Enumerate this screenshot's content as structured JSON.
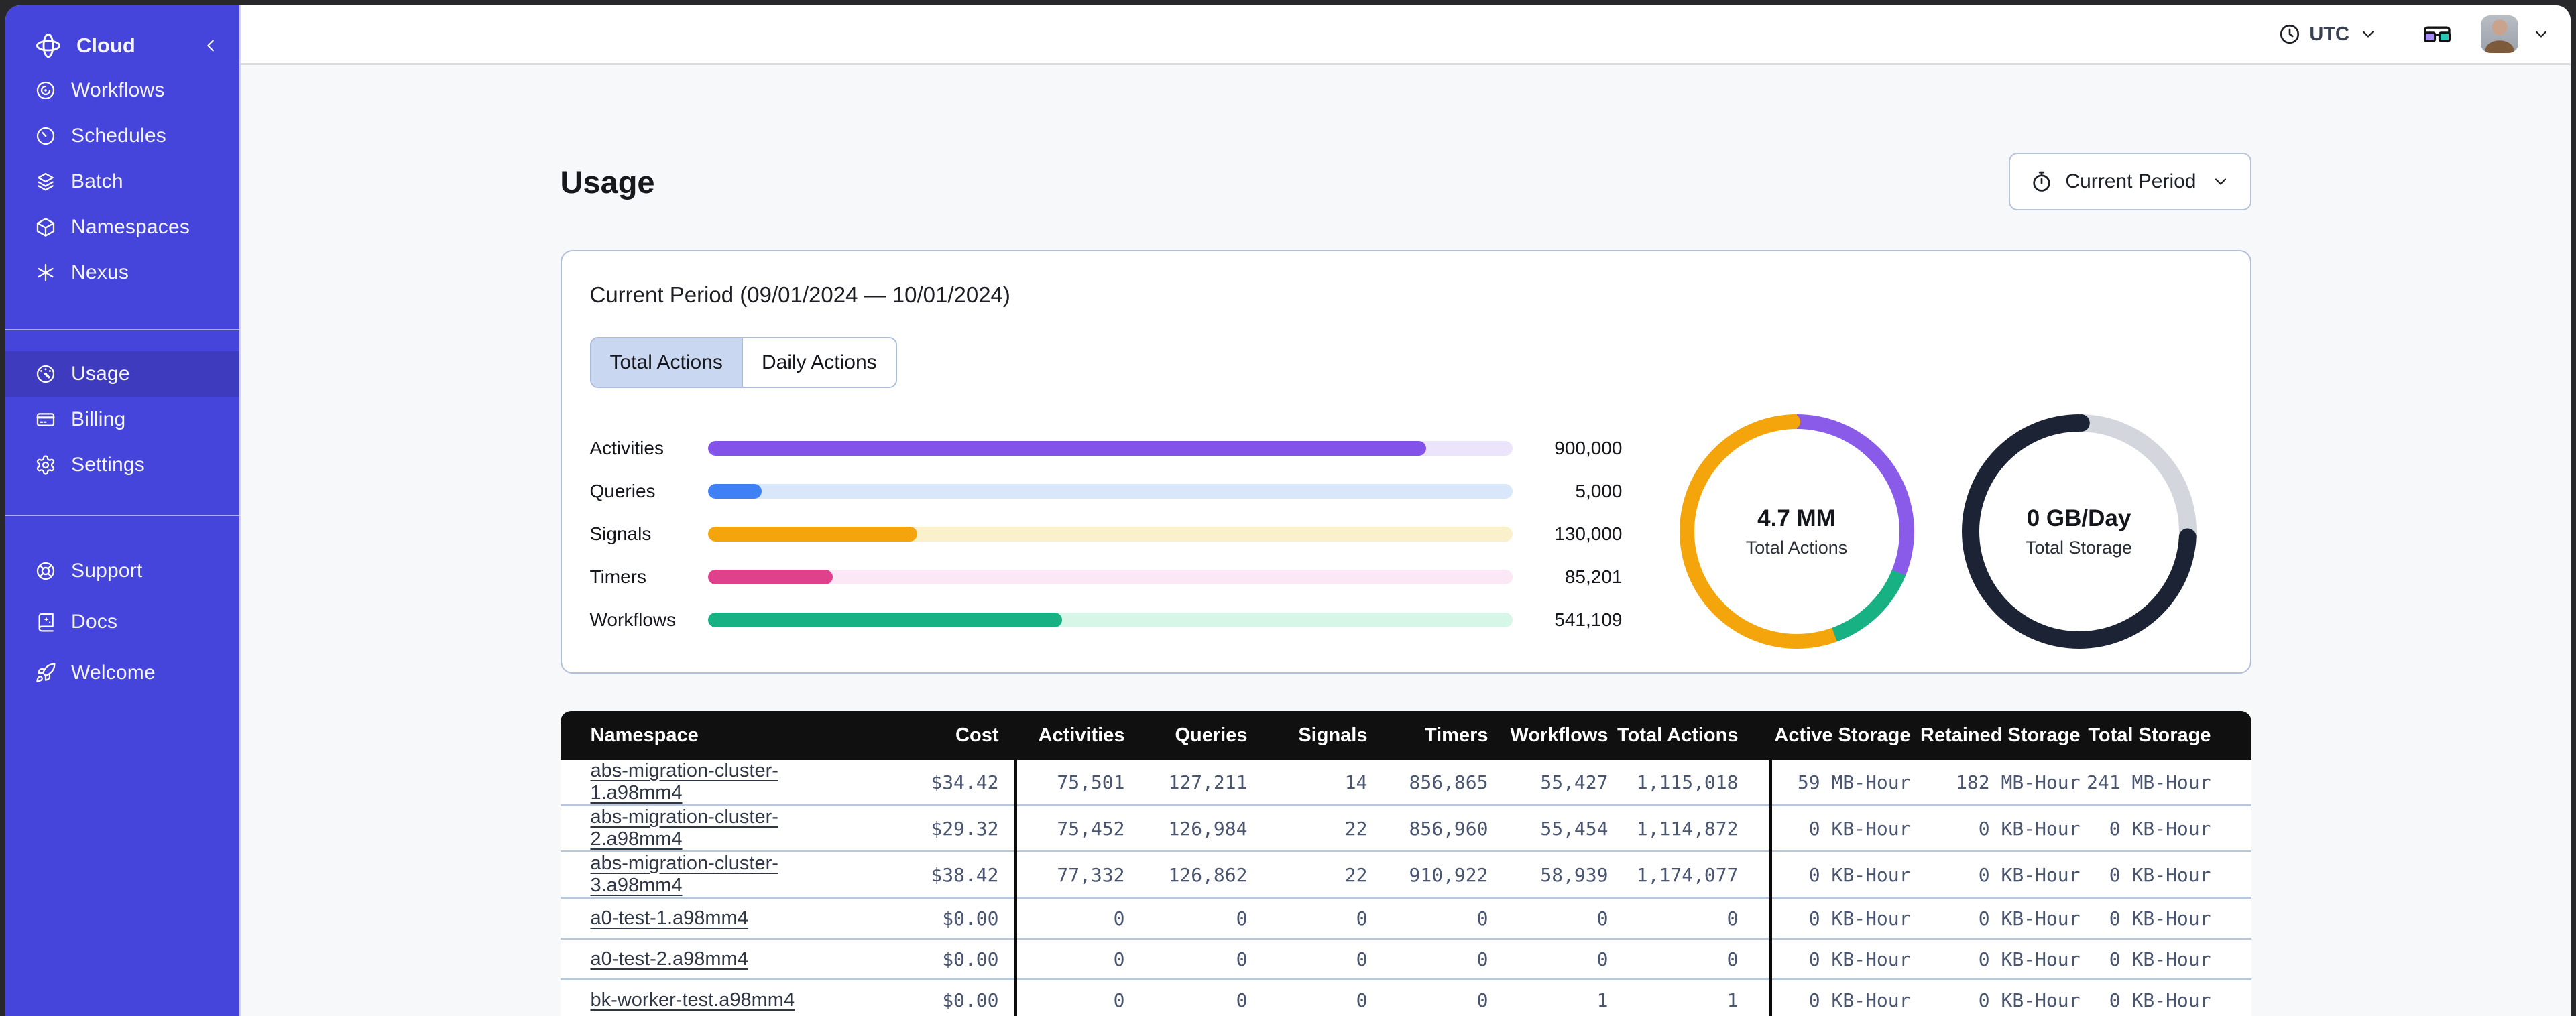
{
  "colors": {
    "sidebar_bg": "#4645DB",
    "sidebar_active_bg": "#3E3BBE",
    "header_bg": "#101010",
    "activities": "#8353E9",
    "queries": "#3F80F4",
    "signals": "#F4A50B",
    "timers": "#E0418C",
    "workflows": "#17B183",
    "storage_dark": "#1B2334",
    "storage_empty": "#D3D6DC"
  },
  "sidebar": {
    "brand": {
      "label": "Cloud"
    },
    "primary_items": [
      {
        "label": "Workflows"
      },
      {
        "label": "Schedules"
      },
      {
        "label": "Batch"
      },
      {
        "label": "Namespaces"
      },
      {
        "label": "Nexus"
      }
    ],
    "account_items": [
      {
        "label": "Usage",
        "active": true
      },
      {
        "label": "Billing"
      },
      {
        "label": "Settings"
      }
    ],
    "footer_items": [
      {
        "label": "Support"
      },
      {
        "label": "Docs"
      },
      {
        "label": "Welcome"
      }
    ]
  },
  "topbar": {
    "timezone": "UTC"
  },
  "page": {
    "title": "Usage",
    "period_selector": "Current Period"
  },
  "usage_card": {
    "title": "Current Period (09/01/2024 — 10/01/2024)",
    "tabs": [
      {
        "label": "Total Actions",
        "selected": true
      },
      {
        "label": "Daily Actions",
        "selected": false
      }
    ],
    "chart_data": {
      "type": "bar",
      "orientation": "horizontal",
      "series": [
        {
          "label": "Activities",
          "value": 900000,
          "value_label": "900,000",
          "pct": "89.3%",
          "color": "#8353E9",
          "track": "#EBE4FB"
        },
        {
          "label": "Queries",
          "value": 5000,
          "value_label": "5,000",
          "pct": "6.7%",
          "color": "#3F80F4",
          "track": "#D9E7FB"
        },
        {
          "label": "Signals",
          "value": 130000,
          "value_label": "130,000",
          "pct": "26%",
          "color": "#F4A50B",
          "track": "#FBF0CC"
        },
        {
          "label": "Timers",
          "value": 85201,
          "value_label": "85,201",
          "pct": "15.5%",
          "color": "#E0418C",
          "track": "#FBE7F6"
        },
        {
          "label": "Workflows",
          "value": 541109,
          "value_label": "541,109",
          "pct": "44%",
          "color": "#17B183",
          "track": "#D6F6E8"
        }
      ]
    },
    "donuts": [
      {
        "value": "4.7 MM",
        "label": "Total Actions",
        "stroke": 22,
        "segments": [
          {
            "color": "#8A5BE8",
            "to": 112
          },
          {
            "color": "#17B183",
            "to": 160
          },
          {
            "color": "#F4A50B",
            "to": 360
          }
        ]
      },
      {
        "value": "0 GB/Day",
        "label": "Total Storage",
        "stroke": 26,
        "segments": [
          {
            "color": "#D3D6DC",
            "to": 94
          },
          {
            "color": "#1B2334",
            "to": 360
          }
        ]
      }
    ]
  },
  "table": {
    "columns": [
      "Namespace",
      "Cost",
      "Activities",
      "Queries",
      "Signals",
      "Timers",
      "Workflows",
      "Total Actions",
      "Active Storage",
      "Retained Storage",
      "Total Storage"
    ],
    "rows": [
      {
        "namespace": "abs-migration-cluster-1.a98mm4",
        "cost": "$34.42",
        "activities": "75,501",
        "queries": "127,211",
        "signals": "14",
        "timers": "856,865",
        "workflows": "55,427",
        "total_actions": "1,115,018",
        "active_storage": "59 MB-Hour",
        "retained_storage": "182 MB-Hour",
        "total_storage": "241 MB-Hour"
      },
      {
        "namespace": "abs-migration-cluster-2.a98mm4",
        "cost": "$29.32",
        "activities": "75,452",
        "queries": "126,984",
        "signals": "22",
        "timers": "856,960",
        "workflows": "55,454",
        "total_actions": "1,114,872",
        "active_storage": "0 KB-Hour",
        "retained_storage": "0 KB-Hour",
        "total_storage": "0 KB-Hour"
      },
      {
        "namespace": "abs-migration-cluster-3.a98mm4",
        "cost": "$38.42",
        "activities": "77,332",
        "queries": "126,862",
        "signals": "22",
        "timers": "910,922",
        "workflows": "58,939",
        "total_actions": "1,174,077",
        "active_storage": "0 KB-Hour",
        "retained_storage": "0 KB-Hour",
        "total_storage": "0 KB-Hour"
      },
      {
        "namespace": "a0-test-1.a98mm4",
        "cost": "$0.00",
        "activities": "0",
        "queries": "0",
        "signals": "0",
        "timers": "0",
        "workflows": "0",
        "total_actions": "0",
        "active_storage": "0 KB-Hour",
        "retained_storage": "0 KB-Hour",
        "total_storage": "0 KB-Hour"
      },
      {
        "namespace": "a0-test-2.a98mm4",
        "cost": "$0.00",
        "activities": "0",
        "queries": "0",
        "signals": "0",
        "timers": "0",
        "workflows": "0",
        "total_actions": "0",
        "active_storage": "0 KB-Hour",
        "retained_storage": "0 KB-Hour",
        "total_storage": "0 KB-Hour"
      },
      {
        "namespace": "bk-worker-test.a98mm4",
        "cost": "$0.00",
        "activities": "0",
        "queries": "0",
        "signals": "0",
        "timers": "0",
        "workflows": "1",
        "total_actions": "1",
        "active_storage": "0 KB-Hour",
        "retained_storage": "0 KB-Hour",
        "total_storage": "0 KB-Hour"
      }
    ]
  }
}
